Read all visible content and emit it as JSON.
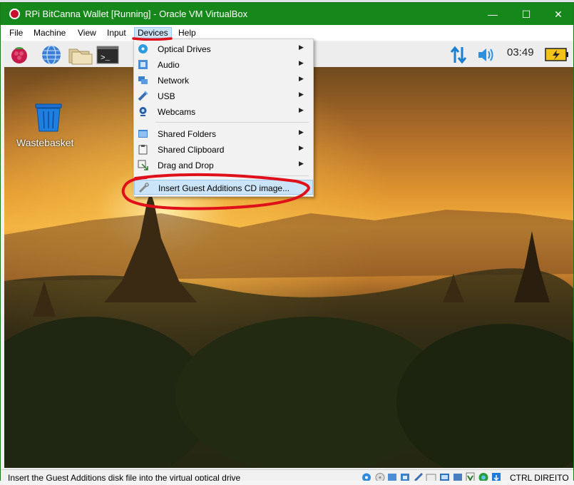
{
  "window": {
    "title": "RPi BitCanna Wallet [Running] - Oracle VM VirtualBox",
    "minimize_glyph": "—",
    "maximize_glyph": "☐",
    "close_glyph": "✕"
  },
  "menubar": {
    "items": [
      "File",
      "Machine",
      "View",
      "Input",
      "Devices",
      "Help"
    ],
    "active": "Devices"
  },
  "guest": {
    "taskbar": {
      "icons": [
        "raspberry-menu-icon",
        "web-browser-icon",
        "file-manager-icon",
        "terminal-icon"
      ],
      "terminal_glyph": ">_",
      "clock": "03:49"
    },
    "desktop": {
      "wastebasket_label": "Wastebasket"
    }
  },
  "devices_menu": {
    "items": [
      {
        "label": "Optical Drives",
        "icon": "optical-drive-icon",
        "submenu": true
      },
      {
        "label": "Audio",
        "icon": "audio-icon",
        "submenu": true
      },
      {
        "label": "Network",
        "icon": "network-icon",
        "submenu": true
      },
      {
        "label": "USB",
        "icon": "usb-icon",
        "submenu": true
      },
      {
        "label": "Webcams",
        "icon": "webcam-icon",
        "submenu": true
      },
      {
        "label": "Shared Folders",
        "icon": "shared-folder-icon",
        "submenu": true
      },
      {
        "label": "Shared Clipboard",
        "icon": "clipboard-icon",
        "submenu": true
      },
      {
        "label": "Drag and Drop",
        "icon": "drag-drop-icon",
        "submenu": true
      },
      {
        "label": "Insert Guest Additions CD image...",
        "icon": "cd-insert-icon",
        "submenu": false
      }
    ],
    "highlighted": "Insert Guest Additions CD image...",
    "submenu_glyph": "▶"
  },
  "statusbar": {
    "message": "Insert the Guest Additions disk file into the virtual optical drive",
    "host_key": "CTRL DIREITO"
  },
  "colors": {
    "titlebar": "#16881b",
    "highlight": "#cce4f7",
    "annotation": "#e0101a"
  }
}
